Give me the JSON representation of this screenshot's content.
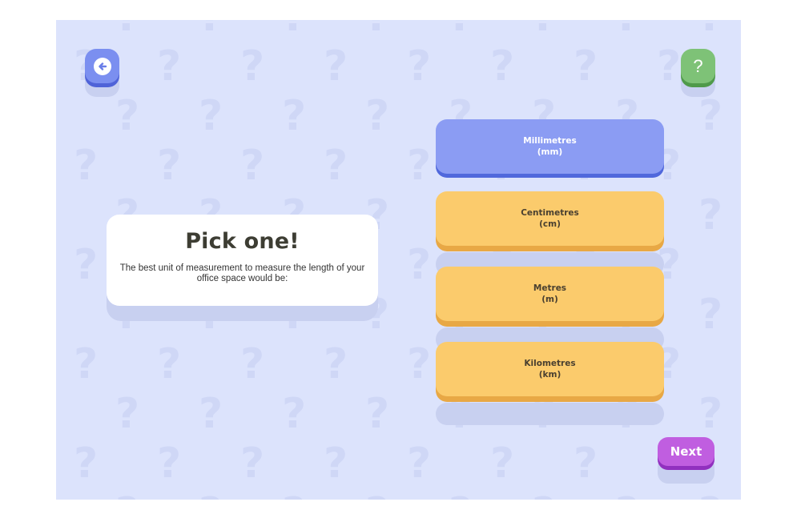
{
  "header": {
    "back_icon": "arrow-left-circle-icon",
    "help_label": "?"
  },
  "question": {
    "title": "Pick one!",
    "text": "The best unit of measurement to measure the length of your office space would be:"
  },
  "options": [
    {
      "label": "Millimetres\n(mm)",
      "selected": true
    },
    {
      "label": "Centimetres\n(cm)",
      "selected": false
    },
    {
      "label": "Metres\n(m)",
      "selected": false
    },
    {
      "label": "Kilometres\n(km)",
      "selected": false
    }
  ],
  "footer": {
    "next_label": "Next"
  },
  "colors": {
    "background": "#dce3fc",
    "selected_option": "#8b9cf3",
    "option": "#fbcb6c",
    "next_button": "#c05ee0",
    "help_button": "#7ec277",
    "back_button": "#7b8ff0"
  }
}
